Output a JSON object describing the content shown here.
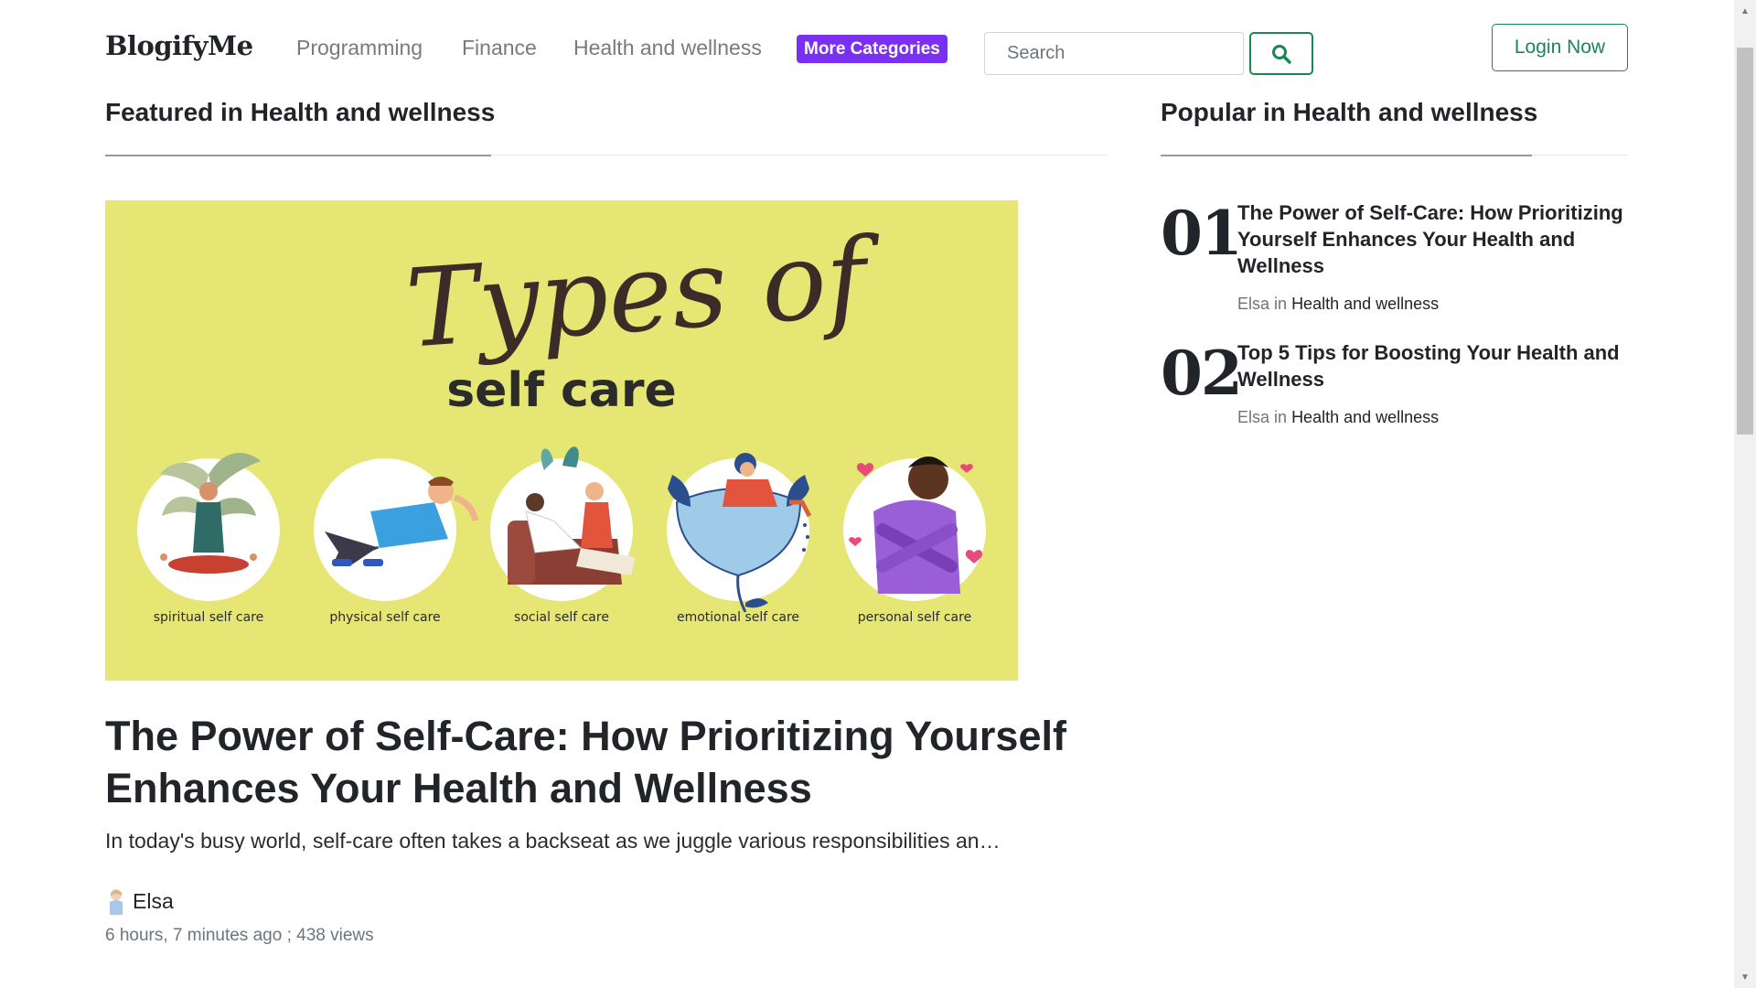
{
  "nav": {
    "brand": "BlogifyMe",
    "links": [
      "Programming",
      "Finance",
      "Health and wellness"
    ],
    "more_label": "More Categories",
    "search_placeholder": "Search",
    "login_label": "Login Now"
  },
  "featured": {
    "heading": "Featured in Health and wellness",
    "image": {
      "script_text": "Types of",
      "title_text": "self care",
      "labels": [
        "spiritual self care",
        "physical self care",
        "social self care",
        "emotional self care",
        "personal self care"
      ]
    },
    "title": "The Power of Self-Care: How Prioritizing Yourself Enhances Your Health and Wellness",
    "excerpt": "In today's busy world, self-care often takes a backseat as we juggle various responsibilities and c…",
    "author": "Elsa",
    "meta": "6 hours, 7 minutes ago ; 438 views"
  },
  "popular": {
    "heading": "Popular in Health and wellness",
    "items": [
      {
        "num": "01",
        "title": "The Power of Self-Care: How Prioritizing Yourself Enhances Your Health and Wellness",
        "author": "Elsa",
        "in": "in",
        "category": "Health and wellness"
      },
      {
        "num": "02",
        "title": "Top 5 Tips for Boosting Your Health and Wellness",
        "author": "Elsa",
        "in": "in",
        "category": "Health and wellness"
      }
    ]
  },
  "colors": {
    "accent": "#7b2ff2",
    "success": "#198754",
    "image_bg": "#e5e674"
  }
}
